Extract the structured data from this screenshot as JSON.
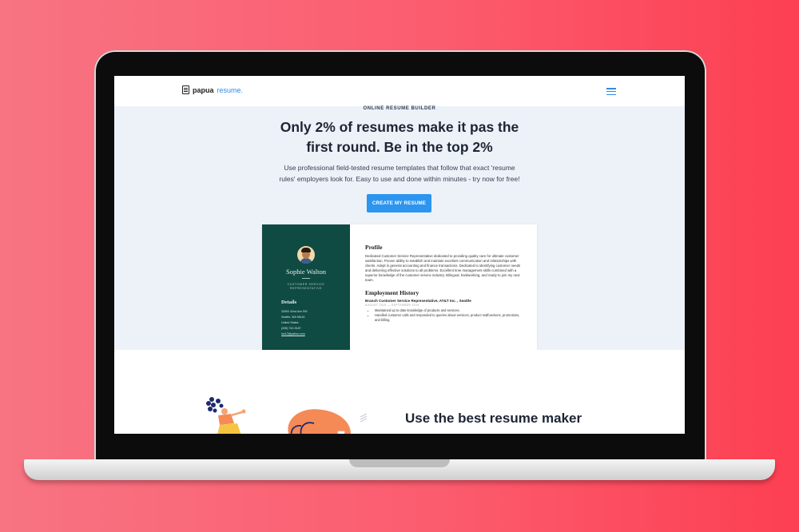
{
  "nav": {
    "logo_main": "papua",
    "logo_accent": "resume."
  },
  "hero": {
    "eyebrow": "ONLINE RESUME BUILDER",
    "headline_line1": "Only 2% of resumes make it pas the",
    "headline_line2": "first round. Be in the top 2%",
    "subtext_line1": "Use professional field-tested resume templates that follow that exact 'resume",
    "subtext_line2": "rules' employers look for. Easy to use and done within minutes - try now for free!",
    "cta_label": "CREATE MY RESUME"
  },
  "resume": {
    "name": "Sophie Walton",
    "role_line1": "CUSTOMER SERVICE",
    "role_line2": "REPRESENTATIVE",
    "details_heading": "Details",
    "details": [
      "32600 42nd Ave SW",
      "Seattle, WA 98116",
      "United States",
      "(206) 742-5187",
      "hw12@yahoo.com"
    ],
    "profile_heading": "Profile",
    "profile_text": "Dedicated Customer Service Representative dedicated to providing quality care for ultimate customer satisfaction. Proven ability to establish and maintain excellent communication and relationships with clients. Adept in general accounting and finance transactions. Dedicated to identifying customer needs and delivering effective solutions to all problems. Excellent time management skills combined with a superior knowledge of the customer service industry. Bilingual, hardworking, and ready to join my next team.",
    "employment_heading": "Employment History",
    "job_title": "Branch Customer Service Representative, AT&T Inc. , Seattle",
    "job_dates": "AUGUST 2019 — SEPTEMBER 2019",
    "job_bullets": [
      "Maintained up to date knowledge of products and services.",
      "Handled customer calls and responded to queries about services, product malfunctions, promotions, and billing."
    ]
  },
  "section": {
    "heading": "Use the best resume maker"
  },
  "colors": {
    "accent": "#2b95f0",
    "resume_sidebar": "#0f4a43",
    "background_gradient_start": "#f87483",
    "background_gradient_end": "#fd3f52"
  }
}
